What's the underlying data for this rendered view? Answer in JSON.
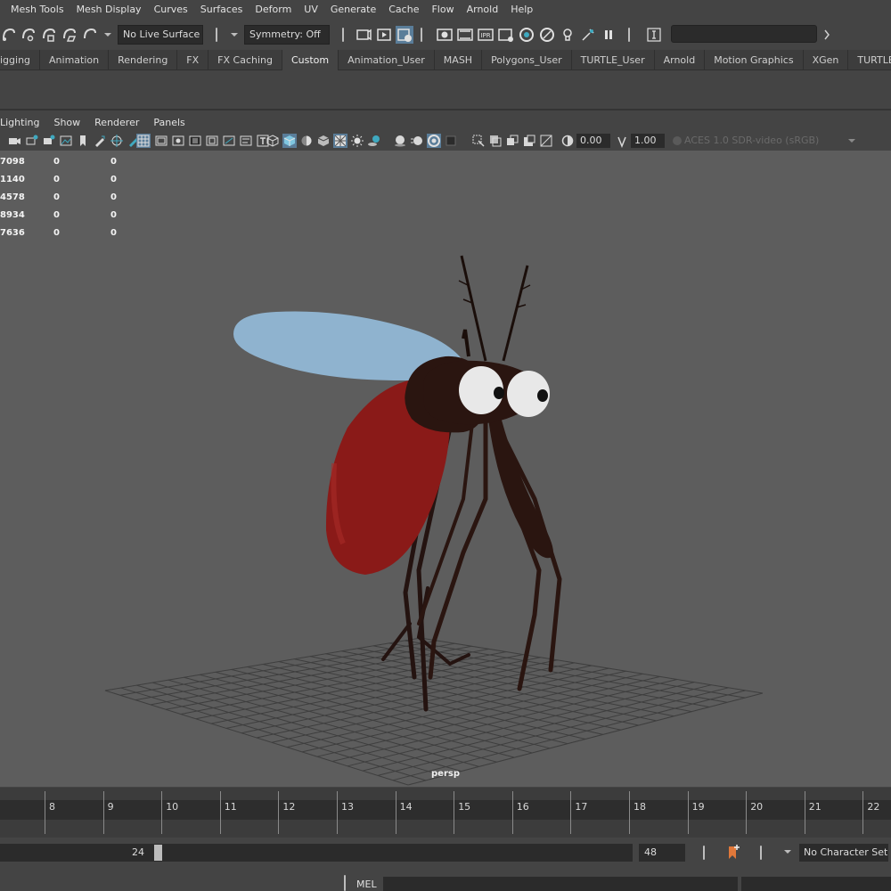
{
  "menubar": {
    "items": [
      "Mesh Tools",
      "Mesh Display",
      "Curves",
      "Surfaces",
      "Deform",
      "UV",
      "Generate",
      "Cache",
      "Flow",
      "Arnold",
      "Help"
    ]
  },
  "statusline": {
    "live_surface": "No Live Surface",
    "symmetry": "Symmetry: Off"
  },
  "shelf": {
    "tabs": [
      "igging",
      "Animation",
      "Rendering",
      "FX",
      "FX Caching",
      "Custom",
      "Animation_User",
      "MASH",
      "Polygons_User",
      "TURTLE_User",
      "Arnold",
      "Motion Graphics",
      "XGen",
      "TURTLE"
    ],
    "active_tab": "Custom"
  },
  "panel": {
    "menu": [
      "Lighting",
      "Show",
      "Renderer",
      "Panels"
    ],
    "exposure": "0.00",
    "gamma": "1.00",
    "color_space": "ACES 1.0 SDR-video (sRGB)"
  },
  "viewport": {
    "camera": "persp",
    "hud_rows": [
      [
        "7098",
        "0",
        "0"
      ],
      [
        "1140",
        "0",
        "0"
      ],
      [
        "4578",
        "0",
        "0"
      ],
      [
        "8934",
        "0",
        "0"
      ],
      [
        "7636",
        "0",
        "0"
      ]
    ],
    "colors": {
      "background": "#5d5d5d",
      "grid": "#3a3a3a",
      "wing": "#8fb3cf",
      "abdomen": "#8a1a18",
      "body": "#2a1510",
      "eye": "#e8e8e8"
    }
  },
  "timeline": {
    "frames": [
      "8",
      "9",
      "10",
      "11",
      "12",
      "13",
      "14",
      "15",
      "16",
      "17",
      "18",
      "19",
      "20",
      "21",
      "22"
    ]
  },
  "range": {
    "start": "24",
    "end": "48",
    "character_set": "No Character Set"
  },
  "cmdline": {
    "label": "MEL"
  }
}
